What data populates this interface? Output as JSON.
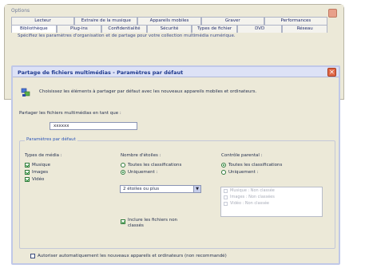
{
  "background_window": {
    "title": "Options",
    "tabs_row1": [
      "Lecteur",
      "Extraire de la musique",
      "Appareils mobiles",
      "Graver",
      "Performances"
    ],
    "tabs_row2": [
      "Bibliothèque",
      "Plug-ins",
      "Confidentialité",
      "Sécurité",
      "Types de fichier",
      "DVD",
      "Réseau"
    ],
    "description": "Spécifiez les paramètres d'organisation et de partage pour votre collection multimédia numérique."
  },
  "dialog": {
    "title": "Partage de fichiers multimédias - Paramètres par défaut",
    "close_label": "✕",
    "lead_text": "Choisissez les éléments à partager par défaut avec les nouveaux appareils mobiles et ordinateurs.",
    "share_label": "Partager les fichiers multimédias en tant que :",
    "share_value": "xxxxxx",
    "group_legend": "Paramètres par défaut",
    "media_types": {
      "heading": "Types de média :",
      "items": [
        {
          "label": "Musique",
          "checked": true
        },
        {
          "label": "Images",
          "checked": true
        },
        {
          "label": "Vidéo",
          "checked": true
        }
      ]
    },
    "stars": {
      "heading": "Nombre d'étoiles :",
      "options": [
        {
          "label": "Toutes les classifications",
          "selected": false
        },
        {
          "label": "Uniquement :",
          "selected": true
        }
      ],
      "select_value": "2 étoiles ou plus",
      "include_unrated_label": "Inclure les fichiers non classés",
      "include_unrated": true
    },
    "parental": {
      "heading": "Contrôle parental :",
      "options": [
        {
          "label": "Toutes les classifications",
          "selected": true
        },
        {
          "label": "Uniquement :",
          "selected": false
        }
      ],
      "list_items": [
        "Musique : Non classée",
        "Images : Non classées",
        "Vidéo : Non classée"
      ]
    },
    "auto_allow_label": "Autoriser automatiquement les nouveaux appareils et ordinateurs (non recommandé)",
    "auto_allow": false
  }
}
